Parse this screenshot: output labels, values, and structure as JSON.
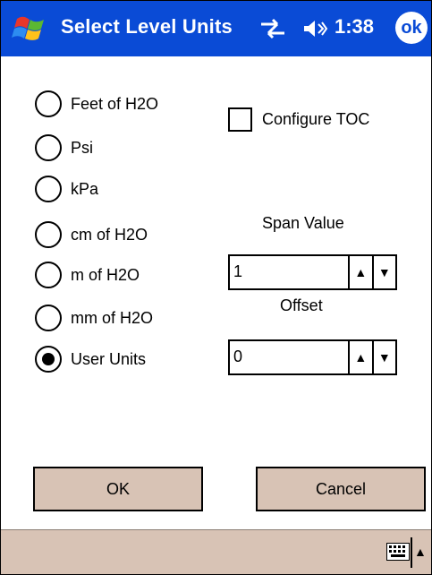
{
  "titlebar": {
    "title": "Select Level Units",
    "clock": "1:38",
    "ok_label": "ok",
    "color": "#0a4bd6"
  },
  "units": {
    "options": [
      {
        "label": "Feet of H2O",
        "checked": false
      },
      {
        "label": "Psi",
        "checked": false
      },
      {
        "label": "kPa",
        "checked": false
      },
      {
        "label": "cm of H2O",
        "checked": false
      },
      {
        "label": "m of H2O",
        "checked": false
      },
      {
        "label": "mm of H2O",
        "checked": false
      },
      {
        "label": "User Units",
        "checked": true
      }
    ]
  },
  "configure_toc": {
    "label": "Configure TOC",
    "checked": false
  },
  "span": {
    "label": "Span Value",
    "value": "1"
  },
  "offset": {
    "label": "Offset",
    "value": "0"
  },
  "buttons": {
    "ok": "OK",
    "cancel": "Cancel"
  },
  "bottombar": {
    "icon": "keyboard-icon",
    "bg": "#d8c3b5"
  }
}
